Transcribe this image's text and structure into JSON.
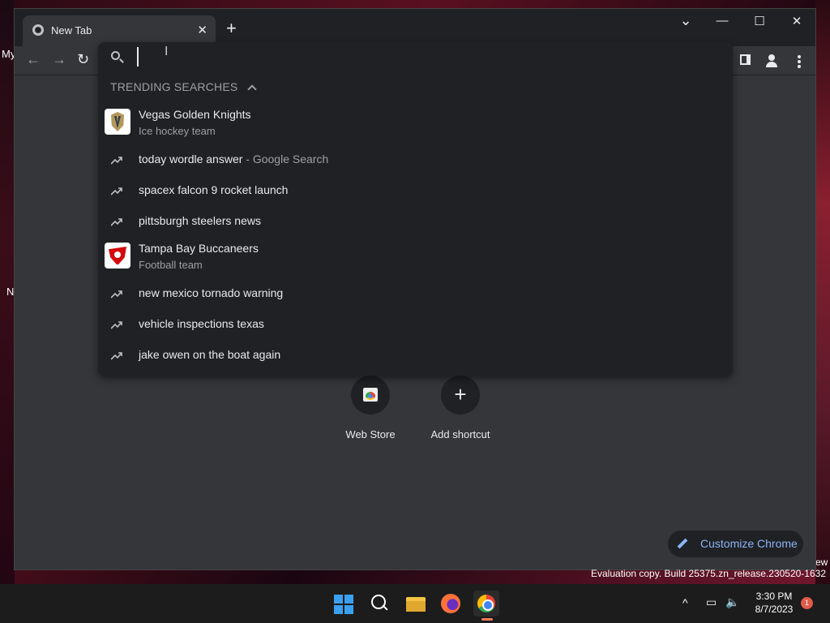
{
  "desktop": {
    "label_my": "My",
    "label_n": "N",
    "label_ew": "ew",
    "eval_text": "Evaluation copy. Build 25375.zn_release.230520-1632"
  },
  "browser": {
    "tab_title": "New Tab",
    "new_tab_symbol": "+",
    "close_symbol": "✕",
    "minimize_symbol": "—",
    "maximize_symbol": "☐",
    "window_close_symbol": "✕",
    "tab_search_symbol": "⌄"
  },
  "omnibox": {
    "input_value": "",
    "trending_header": "TRENDING SEARCHES",
    "suggestions": [
      {
        "text": "Vegas Golden Knights",
        "sub": "Ice hockey team",
        "icon": "vegas-golden-knights-logo"
      },
      {
        "text": "today wordle answer",
        "suffix": " - Google Search",
        "icon": "trending-icon"
      },
      {
        "text": "spacex falcon 9 rocket launch",
        "icon": "trending-icon"
      },
      {
        "text": "pittsburgh steelers news",
        "icon": "trending-icon"
      },
      {
        "text": "Tampa Bay Buccaneers",
        "sub": "Football team",
        "icon": "tampa-bay-buccaneers-logo"
      },
      {
        "text": "new mexico tornado warning",
        "icon": "trending-icon"
      },
      {
        "text": "vehicle inspections texas",
        "icon": "trending-icon"
      },
      {
        "text": "jake owen on the boat again",
        "icon": "trending-icon"
      }
    ]
  },
  "shortcuts": [
    {
      "label": "Web Store",
      "icon": "web-store-icon"
    },
    {
      "label": "Add shortcut",
      "icon": "plus-icon",
      "symbol": "+"
    }
  ],
  "customize": {
    "label": "Customize Chrome"
  },
  "taskbar": {
    "time": "3:30 PM",
    "date": "8/7/2023",
    "notification_count": "1",
    "tray_chevron": "^"
  }
}
